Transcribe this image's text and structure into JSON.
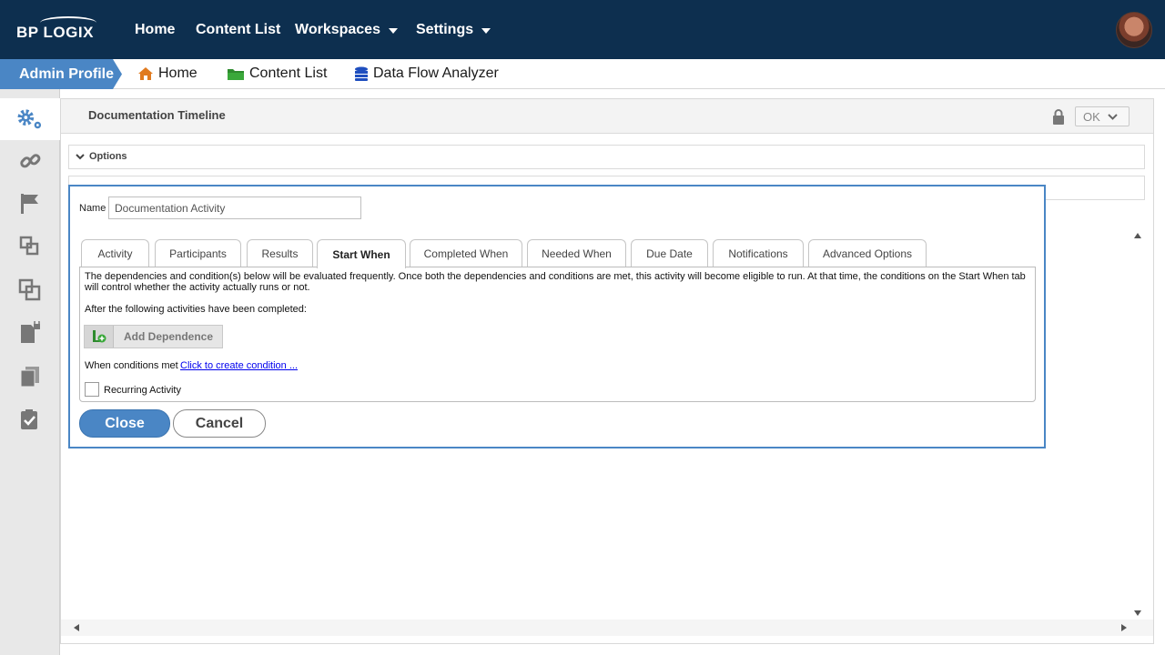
{
  "topbar": {
    "logo_text": "BP LOGIX",
    "nav": {
      "home": "Home",
      "content_list": "Content List",
      "workspaces": "Workspaces",
      "settings": "Settings"
    }
  },
  "subbar": {
    "admin_profile": "Admin Profile",
    "home": "Home",
    "content_list": "Content List",
    "data_flow_analyzer": "Data Flow Analyzer"
  },
  "sidebar": {
    "icons": [
      "gears-icon",
      "link-icon",
      "flag-icon",
      "copy-small-icon",
      "copy-large-icon",
      "locked-document-icon",
      "documents-icon",
      "checklist-icon"
    ]
  },
  "main": {
    "title": "Documentation Timeline",
    "ok_label": "OK",
    "options_label": "Options"
  },
  "dialog": {
    "name_label": "Name",
    "name_value": "Documentation Activity",
    "tabs": [
      {
        "label": "Activity"
      },
      {
        "label": "Participants"
      },
      {
        "label": "Results"
      },
      {
        "label": "Start When"
      },
      {
        "label": "Completed When"
      },
      {
        "label": "Needed When"
      },
      {
        "label": "Due Date"
      },
      {
        "label": "Notifications"
      },
      {
        "label": "Advanced Options"
      }
    ],
    "active_tab": "Start When",
    "description": "The dependencies and condition(s) below will be evaluated frequently. Once both the dependencies and conditions are met, this activity will become eligible to run. At that time, the conditions on the Start When tab will control whether the activity actually runs or not.",
    "after_label": "After the following activities have been completed:",
    "add_dependence": "Add Dependence",
    "conditions_label": "When conditions met",
    "conditions_link": "Click to create condition ...",
    "recurring_label": "Recurring Activity",
    "recurring_checked": false,
    "close_label": "Close",
    "cancel_label": "Cancel"
  },
  "colors": {
    "topbar_bg": "#0d2f4f",
    "accent_blue": "#4a86c5",
    "home_icon": "#e07a1f",
    "folder_icon": "#2e8b2e",
    "db_icon": "#1f4fbf",
    "link_blue": "#0000ee"
  }
}
